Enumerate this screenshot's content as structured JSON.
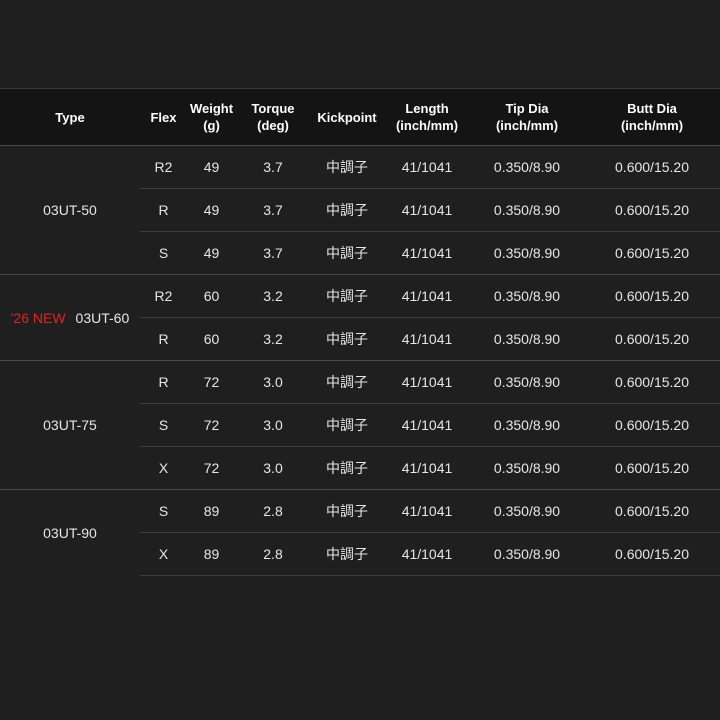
{
  "headers": {
    "type": "Type",
    "flex": "Flex",
    "weight_line1": "Weight",
    "weight_line2": "(g)",
    "torque_line1": "Torque",
    "torque_line2": "(deg)",
    "kickpoint": "Kickpoint",
    "length_line1": "Length",
    "length_line2": "(inch/mm)",
    "tip_line1": "Tip Dia",
    "tip_line2": "(inch/mm)",
    "butt_line1": "Butt Dia",
    "butt_line2": "(inch/mm)"
  },
  "groups": [
    {
      "model": "03UT-50",
      "badge": "",
      "rows": [
        {
          "flex": "R2",
          "weight": "49",
          "torque": "3.7",
          "kickpoint": "中調子",
          "length": "41/1041",
          "tip": "0.350/8.90",
          "butt": "0.600/15.20"
        },
        {
          "flex": "R",
          "weight": "49",
          "torque": "3.7",
          "kickpoint": "中調子",
          "length": "41/1041",
          "tip": "0.350/8.90",
          "butt": "0.600/15.20"
        },
        {
          "flex": "S",
          "weight": "49",
          "torque": "3.7",
          "kickpoint": "中調子",
          "length": "41/1041",
          "tip": "0.350/8.90",
          "butt": "0.600/15.20"
        }
      ]
    },
    {
      "model": "03UT-60",
      "badge": "'26 NEW",
      "rows": [
        {
          "flex": "R2",
          "weight": "60",
          "torque": "3.2",
          "kickpoint": "中調子",
          "length": "41/1041",
          "tip": "0.350/8.90",
          "butt": "0.600/15.20"
        },
        {
          "flex": "R",
          "weight": "60",
          "torque": "3.2",
          "kickpoint": "中調子",
          "length": "41/1041",
          "tip": "0.350/8.90",
          "butt": "0.600/15.20"
        }
      ]
    },
    {
      "model": "03UT-75",
      "badge": "",
      "rows": [
        {
          "flex": "R",
          "weight": "72",
          "torque": "3.0",
          "kickpoint": "中調子",
          "length": "41/1041",
          "tip": "0.350/8.90",
          "butt": "0.600/15.20"
        },
        {
          "flex": "S",
          "weight": "72",
          "torque": "3.0",
          "kickpoint": "中調子",
          "length": "41/1041",
          "tip": "0.350/8.90",
          "butt": "0.600/15.20"
        },
        {
          "flex": "X",
          "weight": "72",
          "torque": "3.0",
          "kickpoint": "中調子",
          "length": "41/1041",
          "tip": "0.350/8.90",
          "butt": "0.600/15.20"
        }
      ]
    },
    {
      "model": "03UT-90",
      "badge": "",
      "rows": [
        {
          "flex": "S",
          "weight": "89",
          "torque": "2.8",
          "kickpoint": "中調子",
          "length": "41/1041",
          "tip": "0.350/8.90",
          "butt": "0.600/15.20"
        },
        {
          "flex": "X",
          "weight": "89",
          "torque": "2.8",
          "kickpoint": "中調子",
          "length": "41/1041",
          "tip": "0.350/8.90",
          "butt": "0.600/15.20"
        }
      ]
    }
  ],
  "colors": {
    "background": "#1f1f1f",
    "header_background": "#141414",
    "new_badge": "#e02424",
    "text": "#ffffff"
  }
}
